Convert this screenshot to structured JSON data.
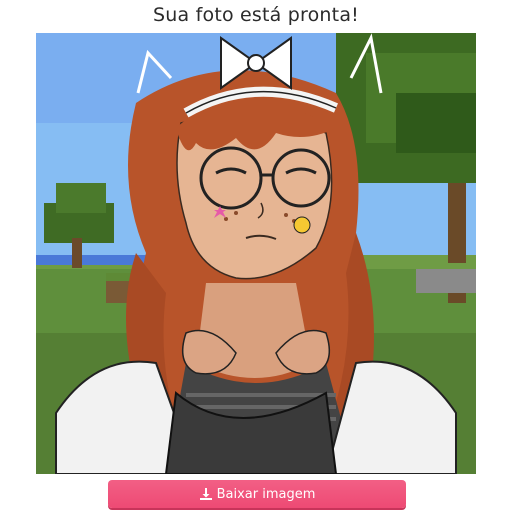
{
  "header": {
    "title": "Sua foto está pronta!"
  },
  "image": {
    "description_icon": "avatar-portrait-image"
  },
  "actions": {
    "download_label": "Baixar imagem",
    "download_icon": "download-icon"
  },
  "colors": {
    "accent": "#f0517a",
    "title_text": "#2b2b2b"
  }
}
